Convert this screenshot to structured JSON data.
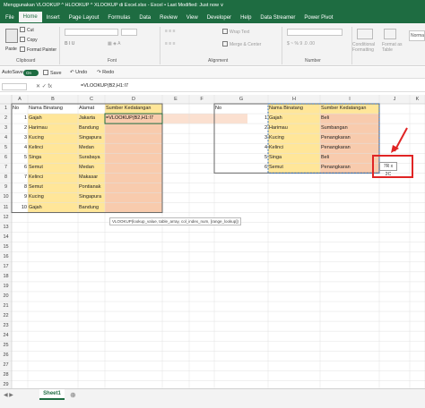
{
  "window": {
    "title": "Menggunakan VLOOKUP ^ HLOOKUP ^ XLOOKUP di Excel.xlsx - Excel • Last Modified: Just now ∨"
  },
  "tabs": [
    "File",
    "Home",
    "Insert",
    "Page Layout",
    "Formulas",
    "Data",
    "Review",
    "View",
    "Developer",
    "Help",
    "Data Streamer",
    "Power Pivot"
  ],
  "active_tab": "Home",
  "ribbon": {
    "paste": "Paste",
    "cut": "Cut",
    "copy": "Copy",
    "format_painter": "Format Painter",
    "wrap_text": "Wrap Text",
    "merge_center": "Merge & Center",
    "conditional_formatting": "Conditional Formatting",
    "format_as_table": "Format as Table",
    "normal": "Norma",
    "groups": {
      "clipboard": "Clipboard",
      "font": "Font",
      "alignment": "Alignment",
      "number": "Number"
    }
  },
  "qat": {
    "autosave": "AutoSave",
    "toggle": "On",
    "save": "Save",
    "undo": "Undo",
    "redo": "Redo"
  },
  "formula_bar": {
    "fx_icons": "✕ ✓ fx",
    "formula": "=VLOOKUP(B2,H1:I7"
  },
  "columns": [
    "A",
    "B",
    "C",
    "D",
    "E",
    "F",
    "G",
    "H",
    "I",
    "J",
    "K"
  ],
  "rows": [
    "1",
    "2",
    "3",
    "4",
    "5",
    "6",
    "7",
    "8",
    "9",
    "10",
    "11",
    "12",
    "13",
    "14",
    "15",
    "16",
    "17",
    "18",
    "19",
    "20",
    "21",
    "22",
    "23",
    "24",
    "25",
    "26",
    "27",
    "28",
    "29"
  ],
  "table1": {
    "headers": [
      "No",
      "Nama Binatang",
      "Alamat",
      "Sumber Kedatangan"
    ],
    "rows": [
      [
        "1",
        "Gajah",
        "Jakarta"
      ],
      [
        "2",
        "Harimau",
        "Bandung"
      ],
      [
        "3",
        "Kucing",
        "Singapura"
      ],
      [
        "4",
        "Kelinci",
        "Medan"
      ],
      [
        "5",
        "Singa",
        "Surabaya"
      ],
      [
        "6",
        "Semut",
        "Medan"
      ],
      [
        "7",
        "Kelinci",
        "Makasar"
      ],
      [
        "8",
        "Semut",
        "Pontianak"
      ],
      [
        "9",
        "Kucing",
        "Singapura"
      ],
      [
        "10",
        "Gajah",
        "Bandung"
      ]
    ],
    "active_formula": "=VLOOKUP(B2,H1:I7"
  },
  "tooltip": "VLOOKUP(lookup_value, table_array, col_index_num, [range_lookup])",
  "table2": {
    "headers": [
      "No",
      "Nama Binatang",
      "Sumber Kedatangan"
    ],
    "rows": [
      [
        "1",
        "Gajah",
        "Beli"
      ],
      [
        "2",
        "Harimau",
        "Sumbangan"
      ],
      [
        "3",
        "Kucing",
        "Penangkaran"
      ],
      [
        "4",
        "Kelinci",
        "Penangkaran"
      ],
      [
        "5",
        "Singa",
        "Beli"
      ],
      [
        "6",
        "Semut",
        "Penangkaran"
      ]
    ]
  },
  "size_tip": "7R x 2C",
  "sheet_tab": "Sheet1",
  "colors": {
    "excel_green": "#1e6c41",
    "yellow_fill": "#ffe699",
    "orange_fill": "#f8cbad",
    "annotation_red": "#e02424"
  }
}
